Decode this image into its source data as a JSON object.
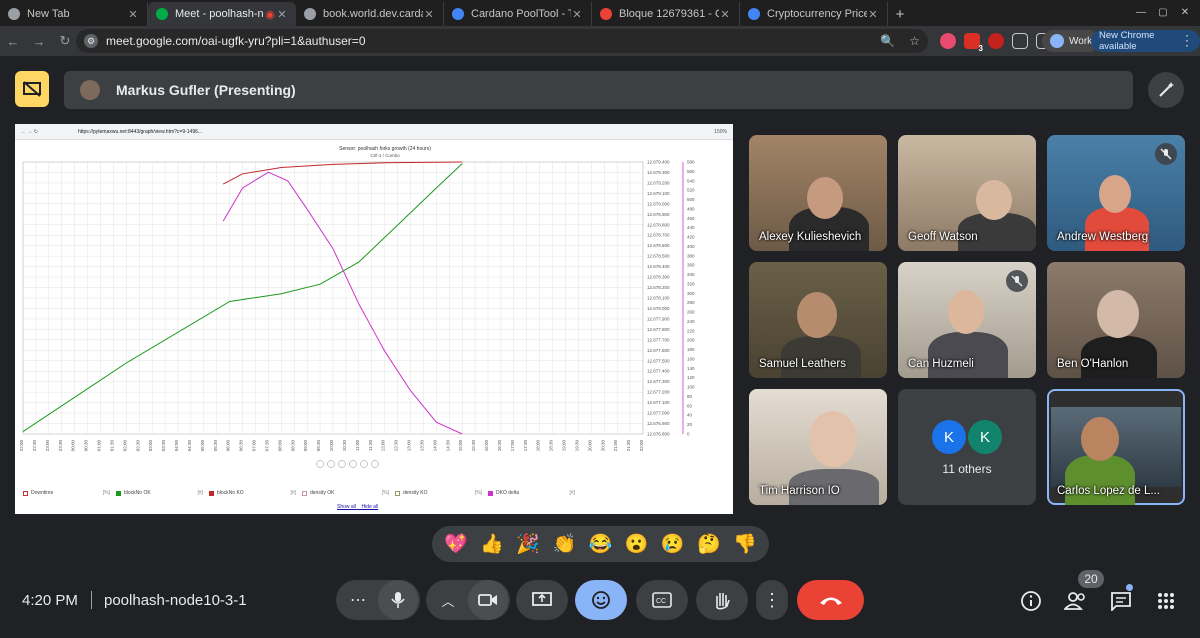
{
  "browser": {
    "tabs": [
      {
        "label": "New Tab",
        "color": "#9aa0a6"
      },
      {
        "label": "Meet - poolhash-nod",
        "color": "#00ac47"
      },
      {
        "label": "book.world.dev.cardan",
        "color": "#9aa0a6"
      },
      {
        "label": "Cardano PoolTool - The",
        "color": "#4285f4"
      },
      {
        "label": "Bloque 12679361 - Card",
        "color": "#ea4335"
      },
      {
        "label": "Cryptocurrency Prices, C",
        "color": "#4285f4"
      }
    ],
    "url": "meet.google.com/oai-ugfk-yru?pli=1&authuser=0",
    "profile_label": "Work",
    "update_label": "New Chrome available",
    "ext_badge": "3"
  },
  "meet": {
    "presenter": "Markus Gufler (Presenting)",
    "participants": [
      {
        "name": "Alexey Kulieshevich"
      },
      {
        "name": "Geoff Watson"
      },
      {
        "name": "Andrew Westberg"
      },
      {
        "name": "Samuel Leathers"
      },
      {
        "name": "Can Huzmeli"
      },
      {
        "name": "Ben O'Hanlon"
      },
      {
        "name": "Tim Harrison IO"
      },
      {
        "name": "Carlos Lopez de L..."
      }
    ],
    "others": {
      "label": "11 others",
      "avatars": [
        "K",
        "K"
      ]
    },
    "reactions": [
      "💖",
      "👍",
      "🎉",
      "👏",
      "😂",
      "😮",
      "😢",
      "🤔",
      "👎"
    ],
    "time": "4:20 PM",
    "meeting_code": "poolhash-node10-3-1",
    "people_count": "20"
  },
  "shared_screen": {
    "address": "https://pytemaxwu.net:8443/graph/view.htm?c=9-1496...",
    "zoom": "150%"
  },
  "chart_data": {
    "type": "line",
    "title": "Sensor: poolhash forks growth (24 hours)",
    "subtitle": "Ctrl-1 / Combo",
    "x_ticks": [
      "22:00",
      "22:30",
      "23:00",
      "23:30",
      "00:00",
      "00:30",
      "01:00",
      "01:30",
      "02:00",
      "02:30",
      "03:00",
      "03:30",
      "04:00",
      "04:30",
      "05:00",
      "05:30",
      "06:00",
      "06:30",
      "07:00",
      "07:30",
      "08:00",
      "08:30",
      "09:00",
      "09:30",
      "10:00",
      "10:30",
      "11:00",
      "11:30",
      "12:00",
      "12:30",
      "13:00",
      "13:30",
      "14:00",
      "14:30",
      "15:00",
      "15:30",
      "16:00",
      "16:30",
      "17:00",
      "17:30",
      "18:00",
      "18:30",
      "19:00",
      "19:30",
      "20:00",
      "20:30",
      "21:00",
      "21:30",
      "22:00"
    ],
    "y1_ticks": [
      "12.679.400",
      "12.679.300",
      "12.679.200",
      "12.679.100",
      "12.679.000",
      "12.678.900",
      "12.678.800",
      "12.678.700",
      "12.678.600",
      "12.678.500",
      "12.678.400",
      "12.678.300",
      "12.678.200",
      "12.678.100",
      "12.678.000",
      "12.677.900",
      "12.677.800",
      "12.677.700",
      "12.677.600",
      "12.677.500",
      "12.677.400",
      "12.677.300",
      "12.677.200",
      "12.677.100",
      "12.677.000",
      "12.676.900",
      "12.676.800"
    ],
    "y2_ticks": [
      "580",
      "560",
      "540",
      "520",
      "500",
      "480",
      "460",
      "440",
      "420",
      "400",
      "380",
      "360",
      "340",
      "320",
      "300",
      "280",
      "260",
      "240",
      "220",
      "200",
      "180",
      "160",
      "140",
      "120",
      "100",
      "80",
      "60",
      "40",
      "20",
      "0"
    ],
    "series": [
      {
        "name": "blockNo OK",
        "color": "#1a9a1a",
        "points": [
          [
            0,
            3
          ],
          [
            8,
            90
          ],
          [
            16,
            168
          ],
          [
            20,
            178
          ],
          [
            23,
            190
          ],
          [
            26,
            218
          ],
          [
            29,
            265
          ],
          [
            32,
            312
          ],
          [
            34,
            343
          ]
        ]
      },
      {
        "name": "blockNo KO",
        "color": "#c0282a",
        "points": [
          [
            15.5,
            317
          ],
          [
            17,
            330
          ],
          [
            20,
            338
          ],
          [
            24,
            342
          ],
          [
            28,
            344
          ],
          [
            34,
            345
          ]
        ]
      },
      {
        "name": "DKO delta",
        "color": "#cc33cc",
        "points": [
          [
            15.5,
            270
          ],
          [
            17,
            312
          ],
          [
            19,
            332
          ],
          [
            20.5,
            321
          ],
          [
            22,
            285
          ],
          [
            24,
            235
          ],
          [
            26,
            165
          ],
          [
            28,
            105
          ],
          [
            30,
            55
          ],
          [
            32,
            15
          ],
          [
            34,
            0
          ]
        ]
      }
    ],
    "legend": [
      {
        "label": "Downtime",
        "count": "[%]",
        "color": "#cc3333"
      },
      {
        "label": "blockNo OK",
        "count": "[#]",
        "color": "#1a9a1a"
      },
      {
        "label": "blockNo KO",
        "count": "[#]",
        "color": "#c0282a"
      },
      {
        "label": "density OK",
        "count": "[%]",
        "color": "#cc9999"
      },
      {
        "label": "density KO",
        "count": "[%]",
        "color": "#999966"
      },
      {
        "label": "DKO delta",
        "count": "[#]",
        "color": "#cc33cc"
      }
    ],
    "show_all": "Show all",
    "hide_all": "Hide all"
  }
}
